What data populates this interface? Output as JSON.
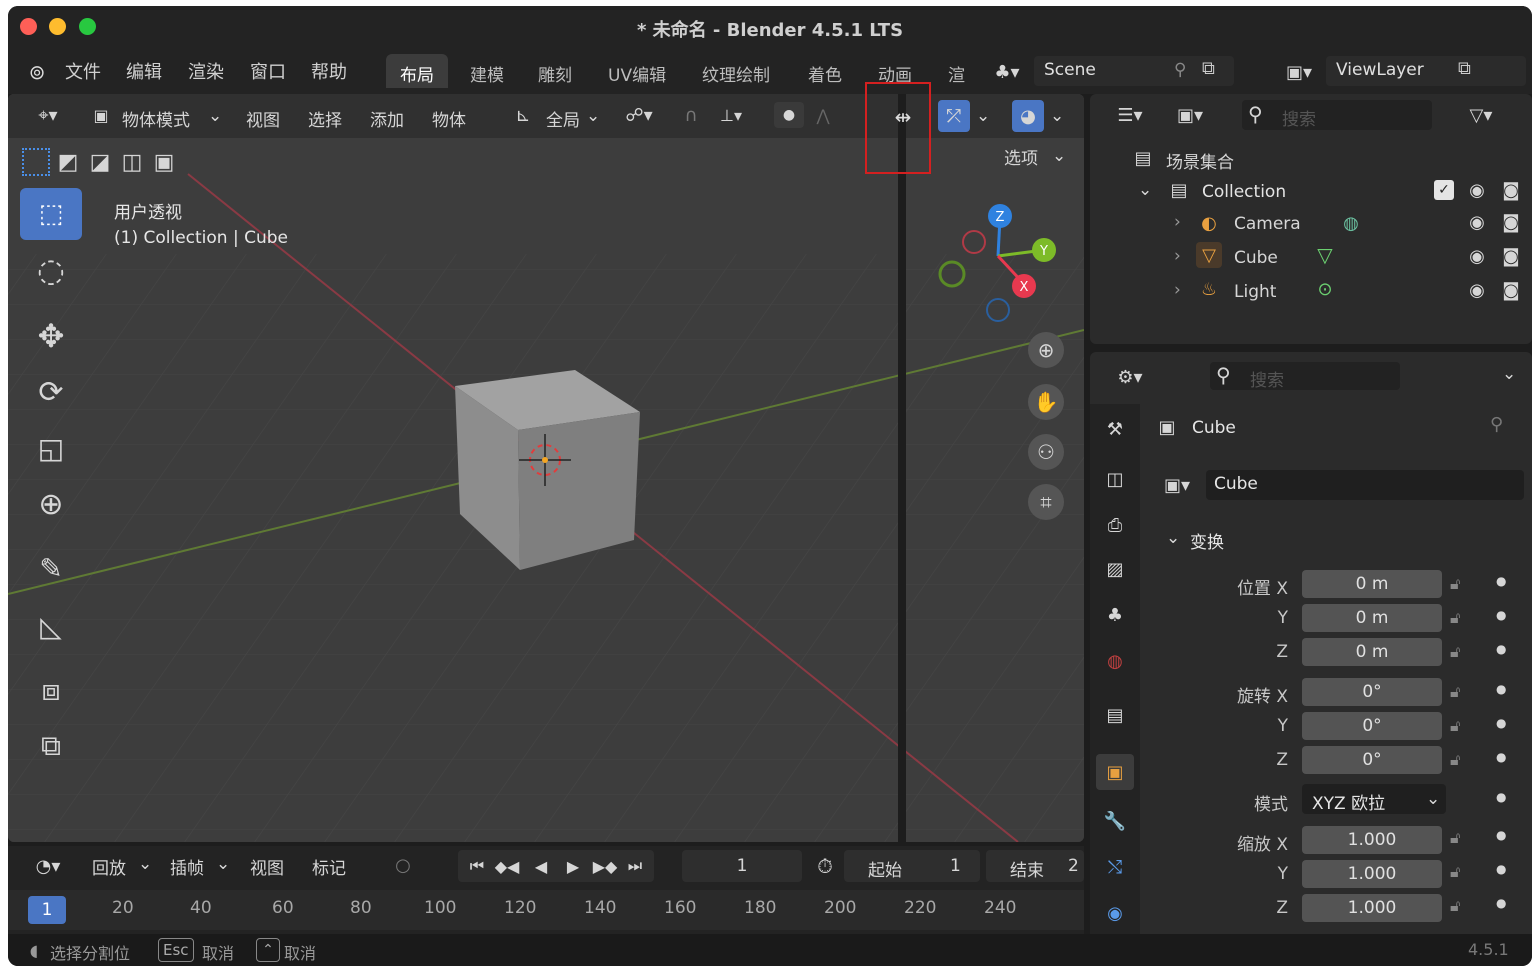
{
  "window": {
    "title": "* 未命名 - Blender 4.5.1 LTS"
  },
  "menu": {
    "items": [
      "文件",
      "编辑",
      "渲染",
      "窗口",
      "帮助"
    ]
  },
  "workspaces": [
    "布局",
    "建模",
    "雕刻",
    "UV编辑",
    "纹理绘制",
    "着色",
    "动画",
    "渲"
  ],
  "scene": {
    "name": "Scene",
    "view_layer": "ViewLayer"
  },
  "viewport": {
    "header": {
      "mode": "物体模式",
      "menus": [
        "视图",
        "选择",
        "添加",
        "物体"
      ],
      "orientation": "全局",
      "options": "选项"
    },
    "overlay_title": "用户透视",
    "overlay_info": "(1) Collection | Cube",
    "gizmo_axes": {
      "z": "Z",
      "y": "Y",
      "x": "X"
    }
  },
  "outliner": {
    "search_placeholder": "搜索",
    "scene_collection": "场景集合",
    "collection": "Collection",
    "objects": [
      {
        "name": "Camera",
        "icon": "camera-icon"
      },
      {
        "name": "Cube",
        "icon": "mesh-icon"
      },
      {
        "name": "Light",
        "icon": "light-icon"
      }
    ]
  },
  "properties": {
    "search_placeholder": "搜索",
    "object_name": "Cube",
    "data_name": "Cube",
    "panel_title": "变换",
    "location": {
      "label_x": "位置 X",
      "x": "0 m",
      "y": "0 m",
      "z": "0 m"
    },
    "rotation": {
      "label_x": "旋转 X",
      "x": "0°",
      "y": "0°",
      "z": "0°"
    },
    "mode": {
      "label": "模式",
      "value": "XYZ 欧拉"
    },
    "scale": {
      "label_x": "缩放 X",
      "x": "1.000",
      "y": "1.000",
      "z": "1.000"
    },
    "axis_y": "Y",
    "axis_z": "Z"
  },
  "timeline": {
    "menus": [
      "回放",
      "插帧",
      "视图",
      "标记"
    ],
    "current_frame": "1",
    "start_label": "起始",
    "start": "1",
    "end_label": "结束",
    "end": "2",
    "ruler": [
      "1",
      "20",
      "40",
      "60",
      "80",
      "100",
      "120",
      "140",
      "160",
      "180",
      "200",
      "220",
      "240"
    ]
  },
  "status": {
    "hint1": "选择分割位",
    "esc": "Esc",
    "hint2": "取消",
    "hint3": "取消",
    "version": "4.5.1"
  },
  "colors": {
    "accent": "#4a76c4",
    "highlight": "#d42020",
    "x_axis": "#e8394f",
    "y_axis": "#7dbb28",
    "z_axis": "#2f82e0"
  }
}
